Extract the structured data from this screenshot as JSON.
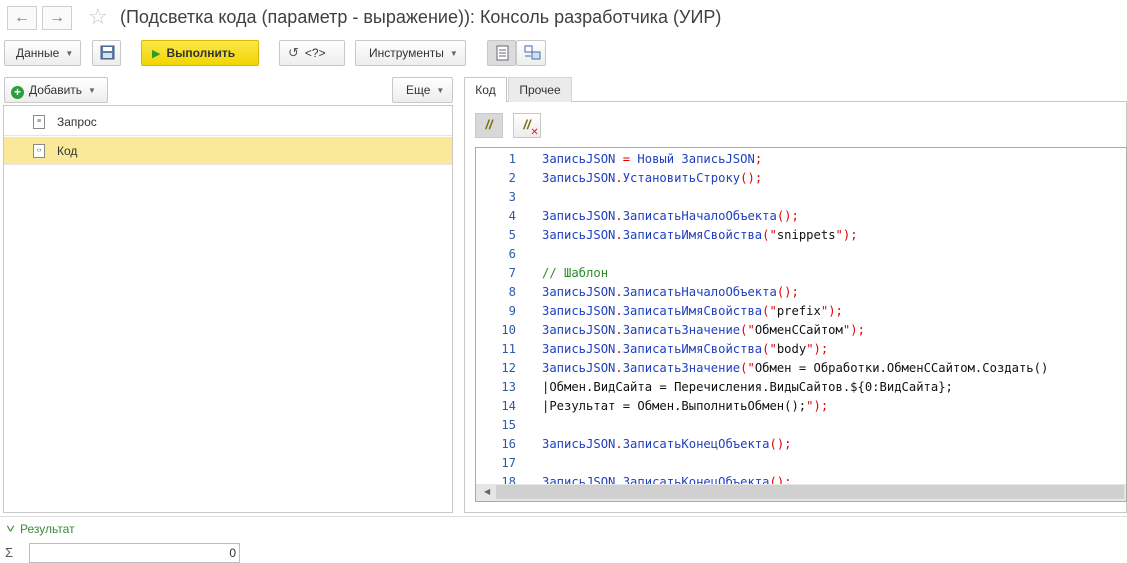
{
  "window": {
    "title": "(Подсветка кода (параметр - выражение)): Консоль разработчика (УИР)",
    "back_glyph": "←",
    "forward_glyph": "→",
    "star_glyph": "☆"
  },
  "toolbar": {
    "data_label": "Данные",
    "run_label": "Выполнить",
    "query_label": "<?>",
    "tools_label": "Инструменты"
  },
  "left": {
    "add_label": "Добавить",
    "more_label": "Еще",
    "items": [
      {
        "label": "Запрос",
        "selected": false
      },
      {
        "label": "Код",
        "selected": true
      }
    ]
  },
  "tabs": [
    {
      "label": "Код",
      "active": true
    },
    {
      "label": "Прочее",
      "active": false
    }
  ],
  "editor": {
    "lines": [
      {
        "n": "1",
        "text": "ЗаписьJSON = Новый ЗаписьJSON;"
      },
      {
        "n": "2",
        "text": "ЗаписьJSON.УстановитьСтроку();"
      },
      {
        "n": "3",
        "text": ""
      },
      {
        "n": "4",
        "text": "ЗаписьJSON.ЗаписатьНачалоОбъекта();"
      },
      {
        "n": "5",
        "text": "ЗаписьJSON.ЗаписатьИмяСвойства(\"snippets\");"
      },
      {
        "n": "6",
        "text": ""
      },
      {
        "n": "7",
        "text": "// Шаблон"
      },
      {
        "n": "8",
        "text": "ЗаписьJSON.ЗаписатьНачалоОбъекта();"
      },
      {
        "n": "9",
        "text": "ЗаписьJSON.ЗаписатьИмяСвойства(\"prefix\");"
      },
      {
        "n": "10",
        "text": "ЗаписьJSON.ЗаписатьЗначение(\"ОбменССайтом\");"
      },
      {
        "n": "11",
        "text": "ЗаписьJSON.ЗаписатьИмяСвойства(\"body\");"
      },
      {
        "n": "12",
        "text": "ЗаписьJSON.ЗаписатьЗначение(\"Обмен = Обработки.ОбменССайтом.Создать();"
      },
      {
        "n": "13",
        "text": "|Обмен.ВидСайта = Перечисления.ВидыСайтов.${0:ВидСайта};"
      },
      {
        "n": "14",
        "text": "|Результат = Обмен.ВыполнитьОбмен();\");"
      },
      {
        "n": "15",
        "text": ""
      },
      {
        "n": "16",
        "text": "ЗаписьJSON.ЗаписатьКонецОбъекта();"
      },
      {
        "n": "17",
        "text": ""
      },
      {
        "n": "18",
        "text": "ЗаписьJSON.ЗаписатьКонецОбъекта();"
      }
    ]
  },
  "result": {
    "label": "Результат",
    "sigma": "Σ",
    "sum_value": "0"
  },
  "colors": {
    "identifier": "#1f3fbf",
    "operator": "#e00000",
    "keyword": "#e00000",
    "string": "#111111",
    "comment": "#2a8a2a",
    "line_number": "#2f5ba8",
    "selected_row": "#fbe99a",
    "run_button": "#f2d500"
  }
}
